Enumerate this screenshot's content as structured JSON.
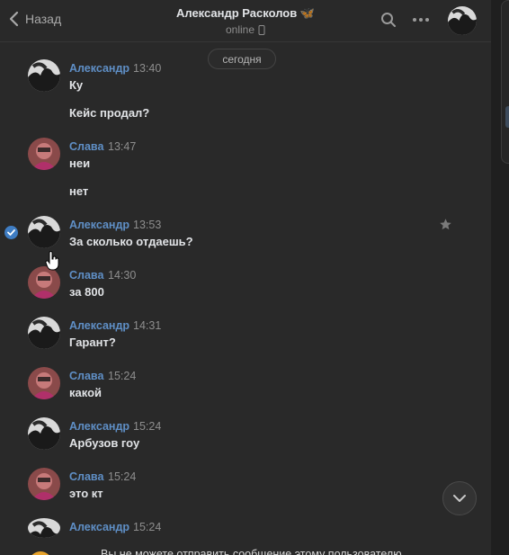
{
  "header": {
    "back_label": "Назад",
    "title": "Александр Расколов 🦋",
    "status": "online"
  },
  "date_divider": "сегодня",
  "messages": [
    {
      "author": "Александр",
      "time": "13:40",
      "lines": [
        "Ку",
        "Кейс продал?"
      ]
    },
    {
      "author": "Слава",
      "time": "13:47",
      "lines": [
        "неи",
        "нет"
      ]
    },
    {
      "author": "Александр",
      "time": "13:53",
      "lines": [
        "За сколько отдаешь?"
      ],
      "selected": true
    },
    {
      "author": "Слава",
      "time": "14:30",
      "lines": [
        "за 800"
      ]
    },
    {
      "author": "Александр",
      "time": "14:31",
      "lines": [
        "Гарант?"
      ]
    },
    {
      "author": "Слава",
      "time": "15:24",
      "lines": [
        "какой"
      ]
    },
    {
      "author": "Александр",
      "time": "15:24",
      "lines": [
        "Арбузов гоу"
      ]
    },
    {
      "author": "Слава",
      "time": "15:24",
      "lines": [
        "это кт"
      ]
    },
    {
      "author": "Александр",
      "time": "15:24",
      "lines": []
    }
  ],
  "footer_notice": "Вы не можете отправить сообщение этому пользователю",
  "colors": {
    "author": "#5f8fc6",
    "background": "#292929",
    "accent": "#3f7dc3"
  }
}
